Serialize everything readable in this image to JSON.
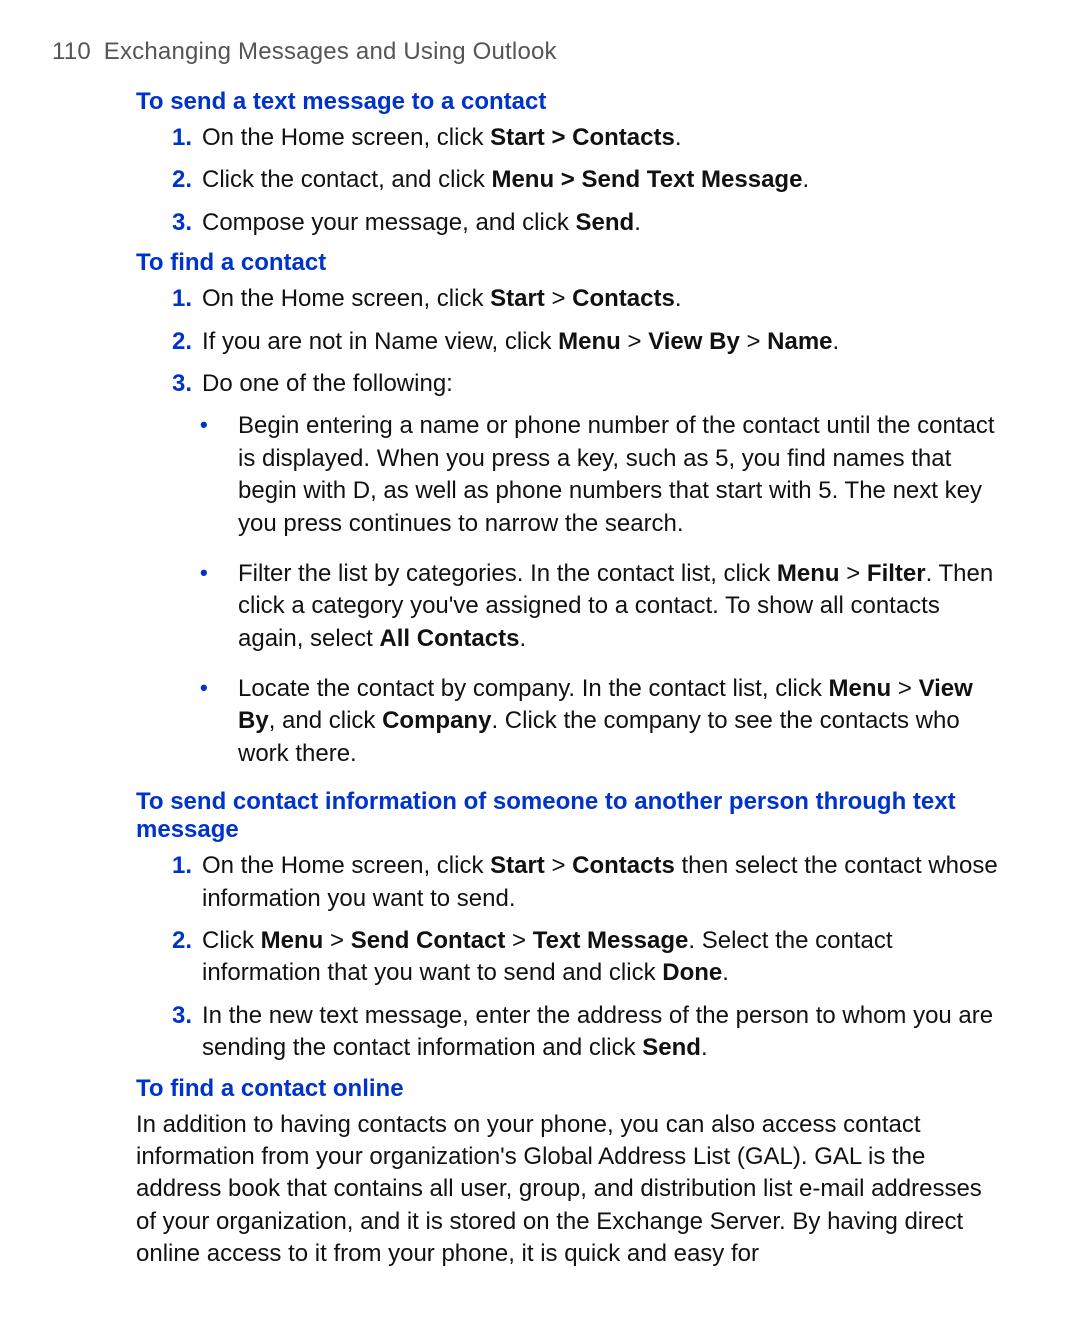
{
  "page": {
    "number": "110",
    "running_title": "Exchanging Messages and Using Outlook"
  },
  "sections": [
    {
      "title": "To send a text message to a contact",
      "items": [
        {
          "marker": "1.",
          "html": "On the Home screen, click <b>Start &gt; Contacts</b>."
        },
        {
          "marker": "2.",
          "html": "Click the contact, and click <b>Menu &gt; Send Text Message</b>."
        },
        {
          "marker": "3.",
          "html": "Compose your message, and click <b>Send</b>."
        }
      ]
    },
    {
      "title": "To find a contact",
      "items": [
        {
          "marker": "1.",
          "html": "On the Home screen, click <b>Start</b> &gt; <b>Contacts</b>."
        },
        {
          "marker": "2.",
          "html": "If you are not in Name view, click <b>Menu</b> &gt; <b>View By</b> &gt; <b>Name</b>."
        },
        {
          "marker": "3.",
          "html": "Do one of the following:"
        }
      ],
      "sub_bullets": [
        "Begin entering a name or phone number of the contact until the contact is displayed. When you press a key, such as 5, you find names that begin with D, as well as phone numbers that start with 5. The next key you press continues to narrow the search.",
        "Filter the list by categories. In the contact list, click <b>Menu</b> &gt; <b>Filter</b>. Then click a category you've assigned to a contact. To show all contacts again, select <b>All Contacts</b>.",
        "Locate the contact by company. In the contact list, click <b>Menu</b> &gt; <b>View By</b>, and click <b>Company</b>. Click the company to see the contacts who work there."
      ]
    },
    {
      "title": "To send contact information of someone to another person through text message",
      "items": [
        {
          "marker": "1.",
          "html": "On the Home screen, click <b>Start</b> &gt; <b>Contacts</b> then select the contact whose information you want to send."
        },
        {
          "marker": "2.",
          "html": "Click <b>Menu</b> &gt; <b>Send Contact</b> &gt; <b>Text Message</b>. Select the contact information that you want to send and click <b>Done</b>."
        },
        {
          "marker": "3.",
          "html": "In the new text message, enter the address of the person to whom you are sending the contact information and click <b>Send</b>."
        }
      ]
    },
    {
      "title": "To find a contact online",
      "body": "In addition to having contacts on your phone, you can also access contact information from your organization's Global Address List (GAL). GAL is the address book that contains all user, group, and distribution list e-mail addresses of your organization, and it is stored on the Exchange Server. By having direct online access to it from your phone, it is quick and easy for"
    }
  ]
}
